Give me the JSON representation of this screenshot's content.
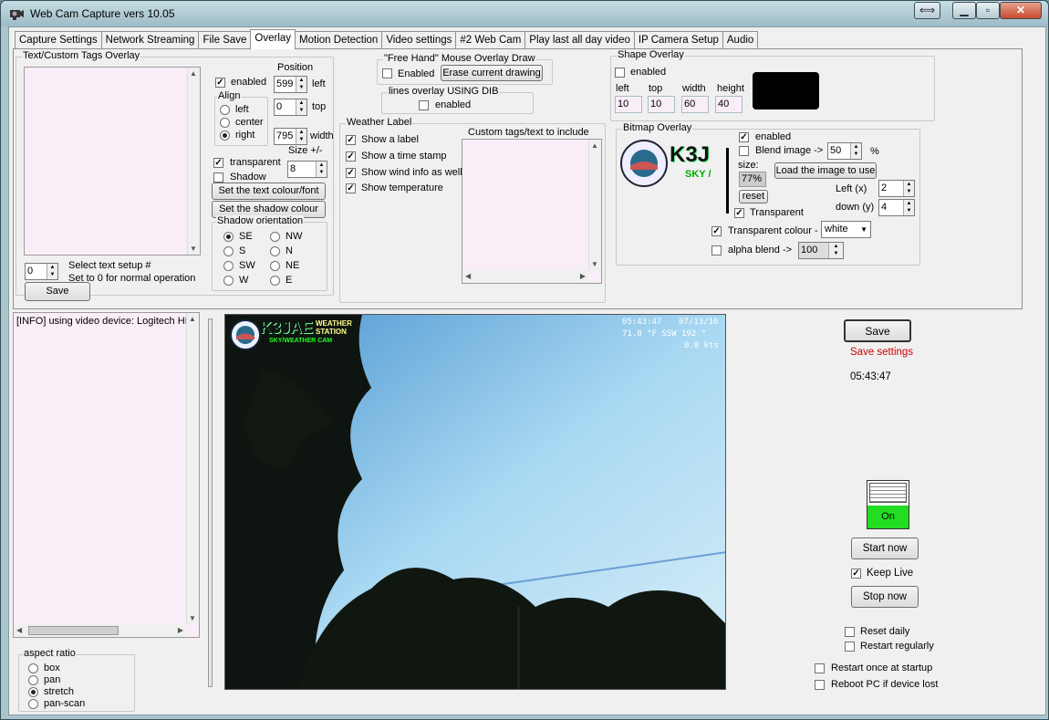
{
  "window": {
    "title": "Web Cam Capture vers 10.05"
  },
  "tabs": [
    "Capture Settings",
    "Network Streaming",
    "File Save",
    "Overlay",
    "Motion Detection",
    "Video settings",
    "#2 Web Cam",
    "Play last all day video",
    "IP Camera Setup",
    "Audio"
  ],
  "text_overlay": {
    "group": "Text/Custom Tags Overlay",
    "enabled": "enabled",
    "position": "Position",
    "left_val": "599",
    "left": "left",
    "top_val": "0",
    "top": "top",
    "width_val": "795",
    "width": "width",
    "align": "Align",
    "align_left": "left",
    "align_center": "center",
    "align_right": "right",
    "transparent": "transparent",
    "shadow": "Shadow",
    "size": "Size +/-",
    "size_val": "8",
    "text_colour_btn": "Set the text colour/font",
    "shadow_colour_btn": "Set the shadow colour",
    "shadow_orientation": "Shadow orientation",
    "orient": [
      "SE",
      "S",
      "SW",
      "W",
      "NW",
      "N",
      "NE",
      "E"
    ],
    "setup_val": "0",
    "select_text": "Select text setup #",
    "set_to_0": "Set to 0 for normal operation",
    "save": "Save"
  },
  "freehand": {
    "group": "\"Free Hand\" Mouse Overlay Draw",
    "enabled": "Enabled",
    "erase": "Erase current drawing"
  },
  "lines": {
    "group": "lines overlay USING DIB",
    "enabled": "enabled"
  },
  "weather": {
    "group": "Weather Label",
    "items": [
      "Show a label",
      "Show a time stamp",
      "Show wind info as well",
      "Show temperature"
    ],
    "custom": "Custom tags/text to include"
  },
  "shape": {
    "group": "Shape Overlay",
    "enabled": "enabled",
    "left": "left",
    "top": "top",
    "width": "width",
    "height": "height",
    "left_val": "10",
    "top_val": "10",
    "width_val": "60",
    "height_val": "40"
  },
  "bitmap": {
    "group": "Bitmap Overlay",
    "enabled": "enabled",
    "blend": "Blend image ->",
    "blend_val": "50",
    "pct": "%",
    "size": "size:",
    "size_val": "77%",
    "load": "Load the image to use",
    "reset": "reset",
    "left_x": "Left (x)",
    "left_val": "2",
    "down_y": "down (y)",
    "down_val": "4",
    "transparent": "Transparent",
    "trans_colour": "Transparent colour -",
    "colour_val": "white",
    "alpha": "alpha blend ->",
    "alpha_val": "100",
    "logo_text": "K3J",
    "logo_sub": "SKY /"
  },
  "log": {
    "line": "[INFO] using video device: Logitech HI"
  },
  "aspect": {
    "group": "aspect ratio",
    "options": [
      "box",
      "pan",
      "stretch",
      "pan-scan"
    ]
  },
  "video": {
    "time": "05:43:47",
    "date": "07/13/16",
    "weather": "71.8 °F SSW 192 °",
    "wind": "0.0 kts",
    "brand": "K3JAE",
    "brand_sub1": "WEATHER",
    "brand_sub2": "STATION",
    "brand_sub3": "SKY/WEATHER CAM"
  },
  "right": {
    "save": "Save",
    "save_settings": "Save settings",
    "clock": "05:43:47",
    "on": "On",
    "start": "Start now",
    "keep_live": "Keep Live",
    "stop": "Stop now",
    "reset_daily": "Reset daily",
    "restart_reg": "Restart regularly",
    "restart_once": "Restart once at startup",
    "reboot": "Reboot PC if device lost"
  },
  "colors": {
    "accent_green": "#22dd22",
    "save_red": "#cc0000",
    "pink_field": "#f9eef7"
  }
}
